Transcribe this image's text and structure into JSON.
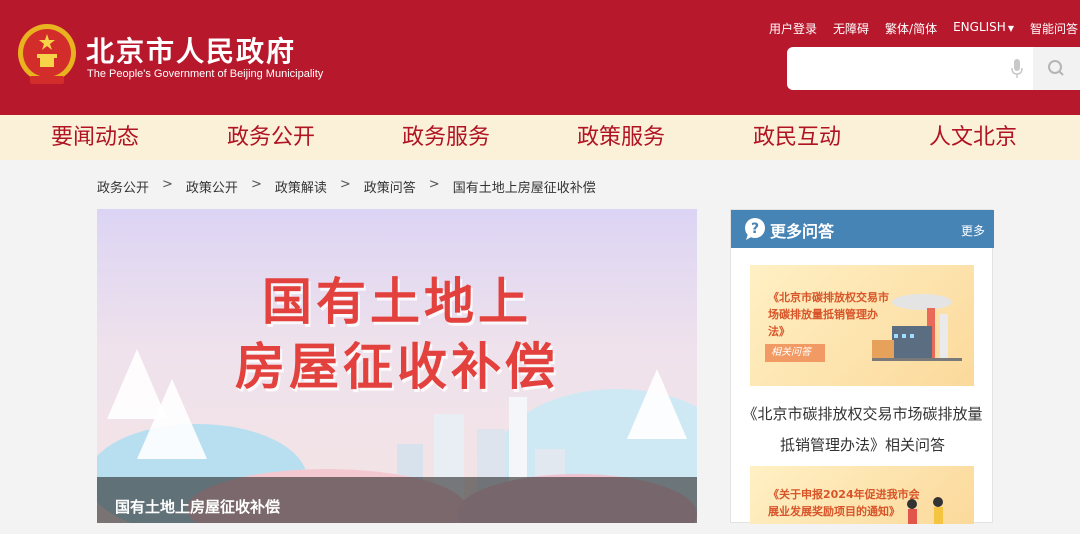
{
  "header": {
    "title": "北京市人民政府",
    "subtitle": "The People's Government of Beijing Municipality",
    "links": [
      "用户登录",
      "无障碍",
      "繁体/简体",
      "ENGLISH",
      "智能问答"
    ]
  },
  "search": {
    "placeholder": ""
  },
  "nav": [
    "要闻动态",
    "政务公开",
    "政务服务",
    "政策服务",
    "政民互动",
    "人文北京"
  ],
  "breadcrumb": [
    "政务公开",
    "政策公开",
    "政策解读",
    "政策问答",
    "国有土地上房屋征收补偿"
  ],
  "banner": {
    "title_line1": "国有土地上",
    "title_line2": "房屋征收补偿",
    "caption": "国有土地上房屋征收补偿"
  },
  "sidebar": {
    "title": "更多问答",
    "more": "更多",
    "cards": [
      {
        "text": "《北京市碳排放权交易市场碳排放量抵销管理办法》",
        "tag": "相关问答"
      },
      {
        "text": "《关于申报2024年促进我市会展业发展奖励项目的通知》",
        "tag": ""
      }
    ],
    "link": "《北京市碳排放权交易市场碳排放量抵销管理办法》相关问答"
  },
  "colors": {
    "brand_red": "#b8182c",
    "nav_bg": "#fbf1d9",
    "side_blue": "#4784b6"
  }
}
